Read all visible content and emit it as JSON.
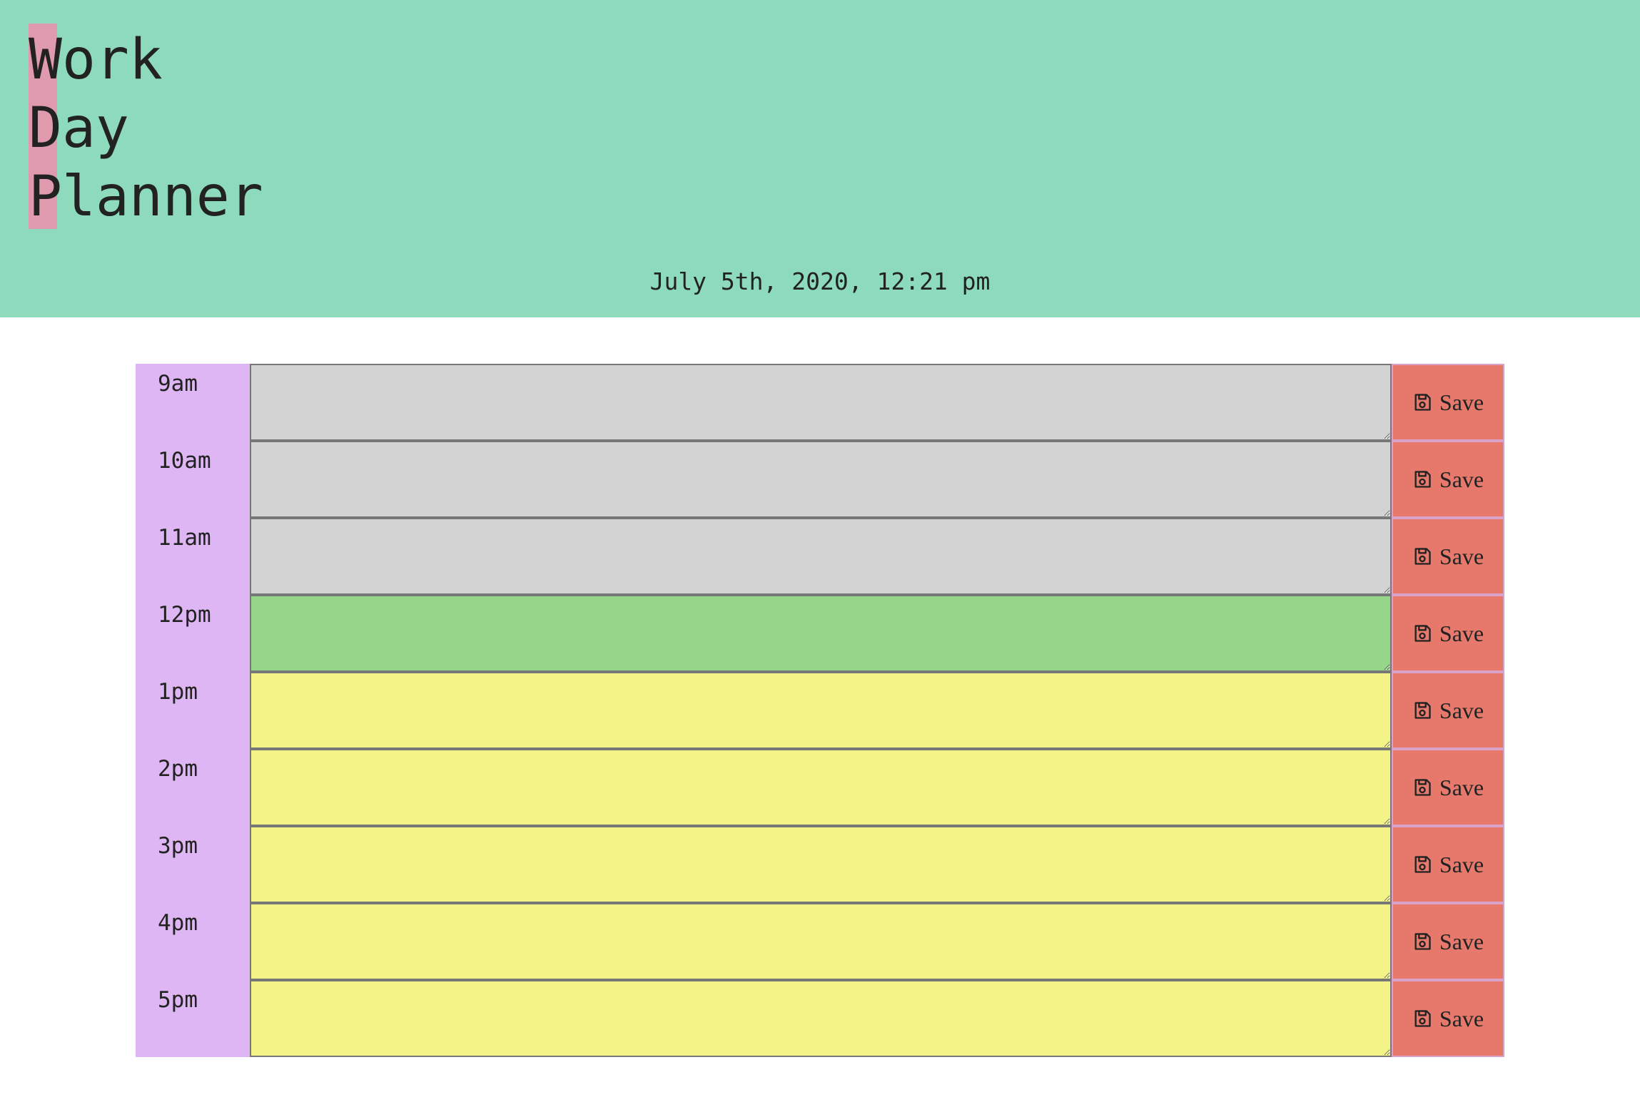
{
  "header": {
    "title_lines": [
      "Work",
      "Day",
      "Planner"
    ],
    "current_day": "July 5th, 2020, 12:21 pm"
  },
  "colors": {
    "header_bg": "#8ddbbc",
    "title_highlight": "#e09aae",
    "hour_bg": "#dfb6f4",
    "past": "#d3d3d3",
    "present": "#96d68a",
    "future": "#f3f387",
    "save_bg": "#e6796b"
  },
  "rows": [
    {
      "hour": "9am",
      "status": "past",
      "task": "",
      "save_label": "Save",
      "save_icon": "save-icon"
    },
    {
      "hour": "10am",
      "status": "past",
      "task": "",
      "save_label": "Save",
      "save_icon": "save-icon"
    },
    {
      "hour": "11am",
      "status": "past",
      "task": "",
      "save_label": "Save",
      "save_icon": "save-icon"
    },
    {
      "hour": "12pm",
      "status": "present",
      "task": "",
      "save_label": "Save",
      "save_icon": "save-icon"
    },
    {
      "hour": "1pm",
      "status": "future",
      "task": "",
      "save_label": "Save",
      "save_icon": "save-icon"
    },
    {
      "hour": "2pm",
      "status": "future",
      "task": "",
      "save_label": "Save",
      "save_icon": "save-icon"
    },
    {
      "hour": "3pm",
      "status": "future",
      "task": "",
      "save_label": "Save",
      "save_icon": "save-icon"
    },
    {
      "hour": "4pm",
      "status": "future",
      "task": "",
      "save_label": "Save",
      "save_icon": "save-icon"
    },
    {
      "hour": "5pm",
      "status": "future",
      "task": "",
      "save_label": "Save",
      "save_icon": "save-icon"
    }
  ]
}
